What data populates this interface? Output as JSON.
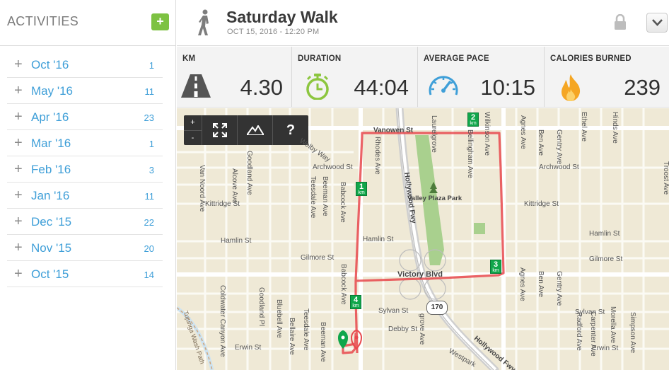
{
  "sidebar": {
    "title": "ACTIVITIES",
    "add_label": "+",
    "months": [
      {
        "label": "Oct '16",
        "count": "1"
      },
      {
        "label": "May '16",
        "count": "11"
      },
      {
        "label": "Apr '16",
        "count": "23"
      },
      {
        "label": "Mar '16",
        "count": "1"
      },
      {
        "label": "Feb '16",
        "count": "3"
      },
      {
        "label": "Jan '16",
        "count": "11"
      },
      {
        "label": "Dec '15",
        "count": "22"
      },
      {
        "label": "Nov '15",
        "count": "20"
      },
      {
        "label": "Oct '15",
        "count": "14"
      }
    ],
    "plus_glyph": "+"
  },
  "header": {
    "title": "Saturday Walk",
    "date": "OCT 15, 2016  -  12:20 PM",
    "icons": {
      "activity": "walker-icon",
      "lock": "lock-icon",
      "menu": "chevron-down-icon"
    }
  },
  "stats": [
    {
      "label": "KM",
      "value": "4.30",
      "icon": "road-icon",
      "color": "#555555"
    },
    {
      "label": "DURATION",
      "value": "44:04",
      "icon": "stopwatch-icon",
      "color": "#8cc63f"
    },
    {
      "label": "AVERAGE PACE",
      "value": "10:15",
      "icon": "speedometer-icon",
      "color": "#3f9fd8"
    },
    {
      "label": "CALORIES BURNED",
      "value": "239",
      "icon": "flame-icon",
      "color": "#f5a623"
    }
  ],
  "map": {
    "controls": {
      "zoom_in": "+",
      "zoom_out": "-",
      "help": "?"
    },
    "streets": {
      "vanowen": "Vanowen St",
      "welby": "Welby Way",
      "archwood_w": "Archwood St",
      "archwood_e": "Archwood St",
      "kittridge_w": "Kittridge St",
      "kittridge_e": "Kittridge St",
      "hamlin_w": "Hamlin St",
      "hamlin_m": "Hamlin St",
      "hamlin_e": "Hamlin St",
      "gilmore_w": "Gilmore St",
      "gilmore_e": "Gilmore St",
      "victory": "Victory Blvd",
      "sylvan_w": "Sylvan St",
      "sylvan_e": "Sylvan St",
      "debby": "Debby St",
      "erwin_w": "Erwin St",
      "erwin_e": "Erwin St",
      "park": "Valley Plaza Park",
      "van_noord": "Van Noord Ave",
      "alcove": "Alcove Ave",
      "goodland": "Goodland Ave",
      "goodland_s": "Goodland Pl",
      "teesdale": "Teesdale Ave",
      "teesdale_s": "Teesdale Ave",
      "beeman": "Beeman Ave",
      "beeman_s": "Beeman Ave",
      "babcock": "Babcock Ave",
      "babcock_s": "Babcock Ave",
      "rhodes": "Rhodes Ave",
      "laurelgrove": "Laurelgrove",
      "bellingham": "Bellingham Ave",
      "wilkinson": "Wilkinson Ave",
      "agnes": "Agnes Ave",
      "agnes_s": "Agnes Ave",
      "ben": "Ben Ave",
      "ben_s": "Ben Ave",
      "gentry": "Gentry Ave",
      "gentry_s": "Gentry Ave",
      "troost": "Troost Ave",
      "hinds": "Hinds Ave",
      "ethel": "Ethel Ave",
      "bluebell": "Bluebell Ave",
      "bellaire": "Bellaire Ave",
      "radford": "Radford Ave",
      "carpenter": "Carpenter Ave",
      "morella": "Morella Ave",
      "simpson": "Simpson Ave",
      "hollywood_fwy": "Hollywood Fwy",
      "hollywood_fwy_s": "Hollywood Fwy",
      "westpark": "Westpark",
      "grove": "grove Ave",
      "coldwater": "Coldwater Canyon Ave",
      "wash": "Tujunga Wash Path",
      "highway": "170"
    },
    "km_markers": [
      {
        "num": "1",
        "unit": "km"
      },
      {
        "num": "2",
        "unit": "km"
      },
      {
        "num": "3",
        "unit": "km"
      },
      {
        "num": "4",
        "unit": "km"
      }
    ],
    "route_color": "#e8484c",
    "park_color": "#a9d08e",
    "pins": {
      "start": "start-pin-icon",
      "end": "end-pin-icon"
    }
  }
}
